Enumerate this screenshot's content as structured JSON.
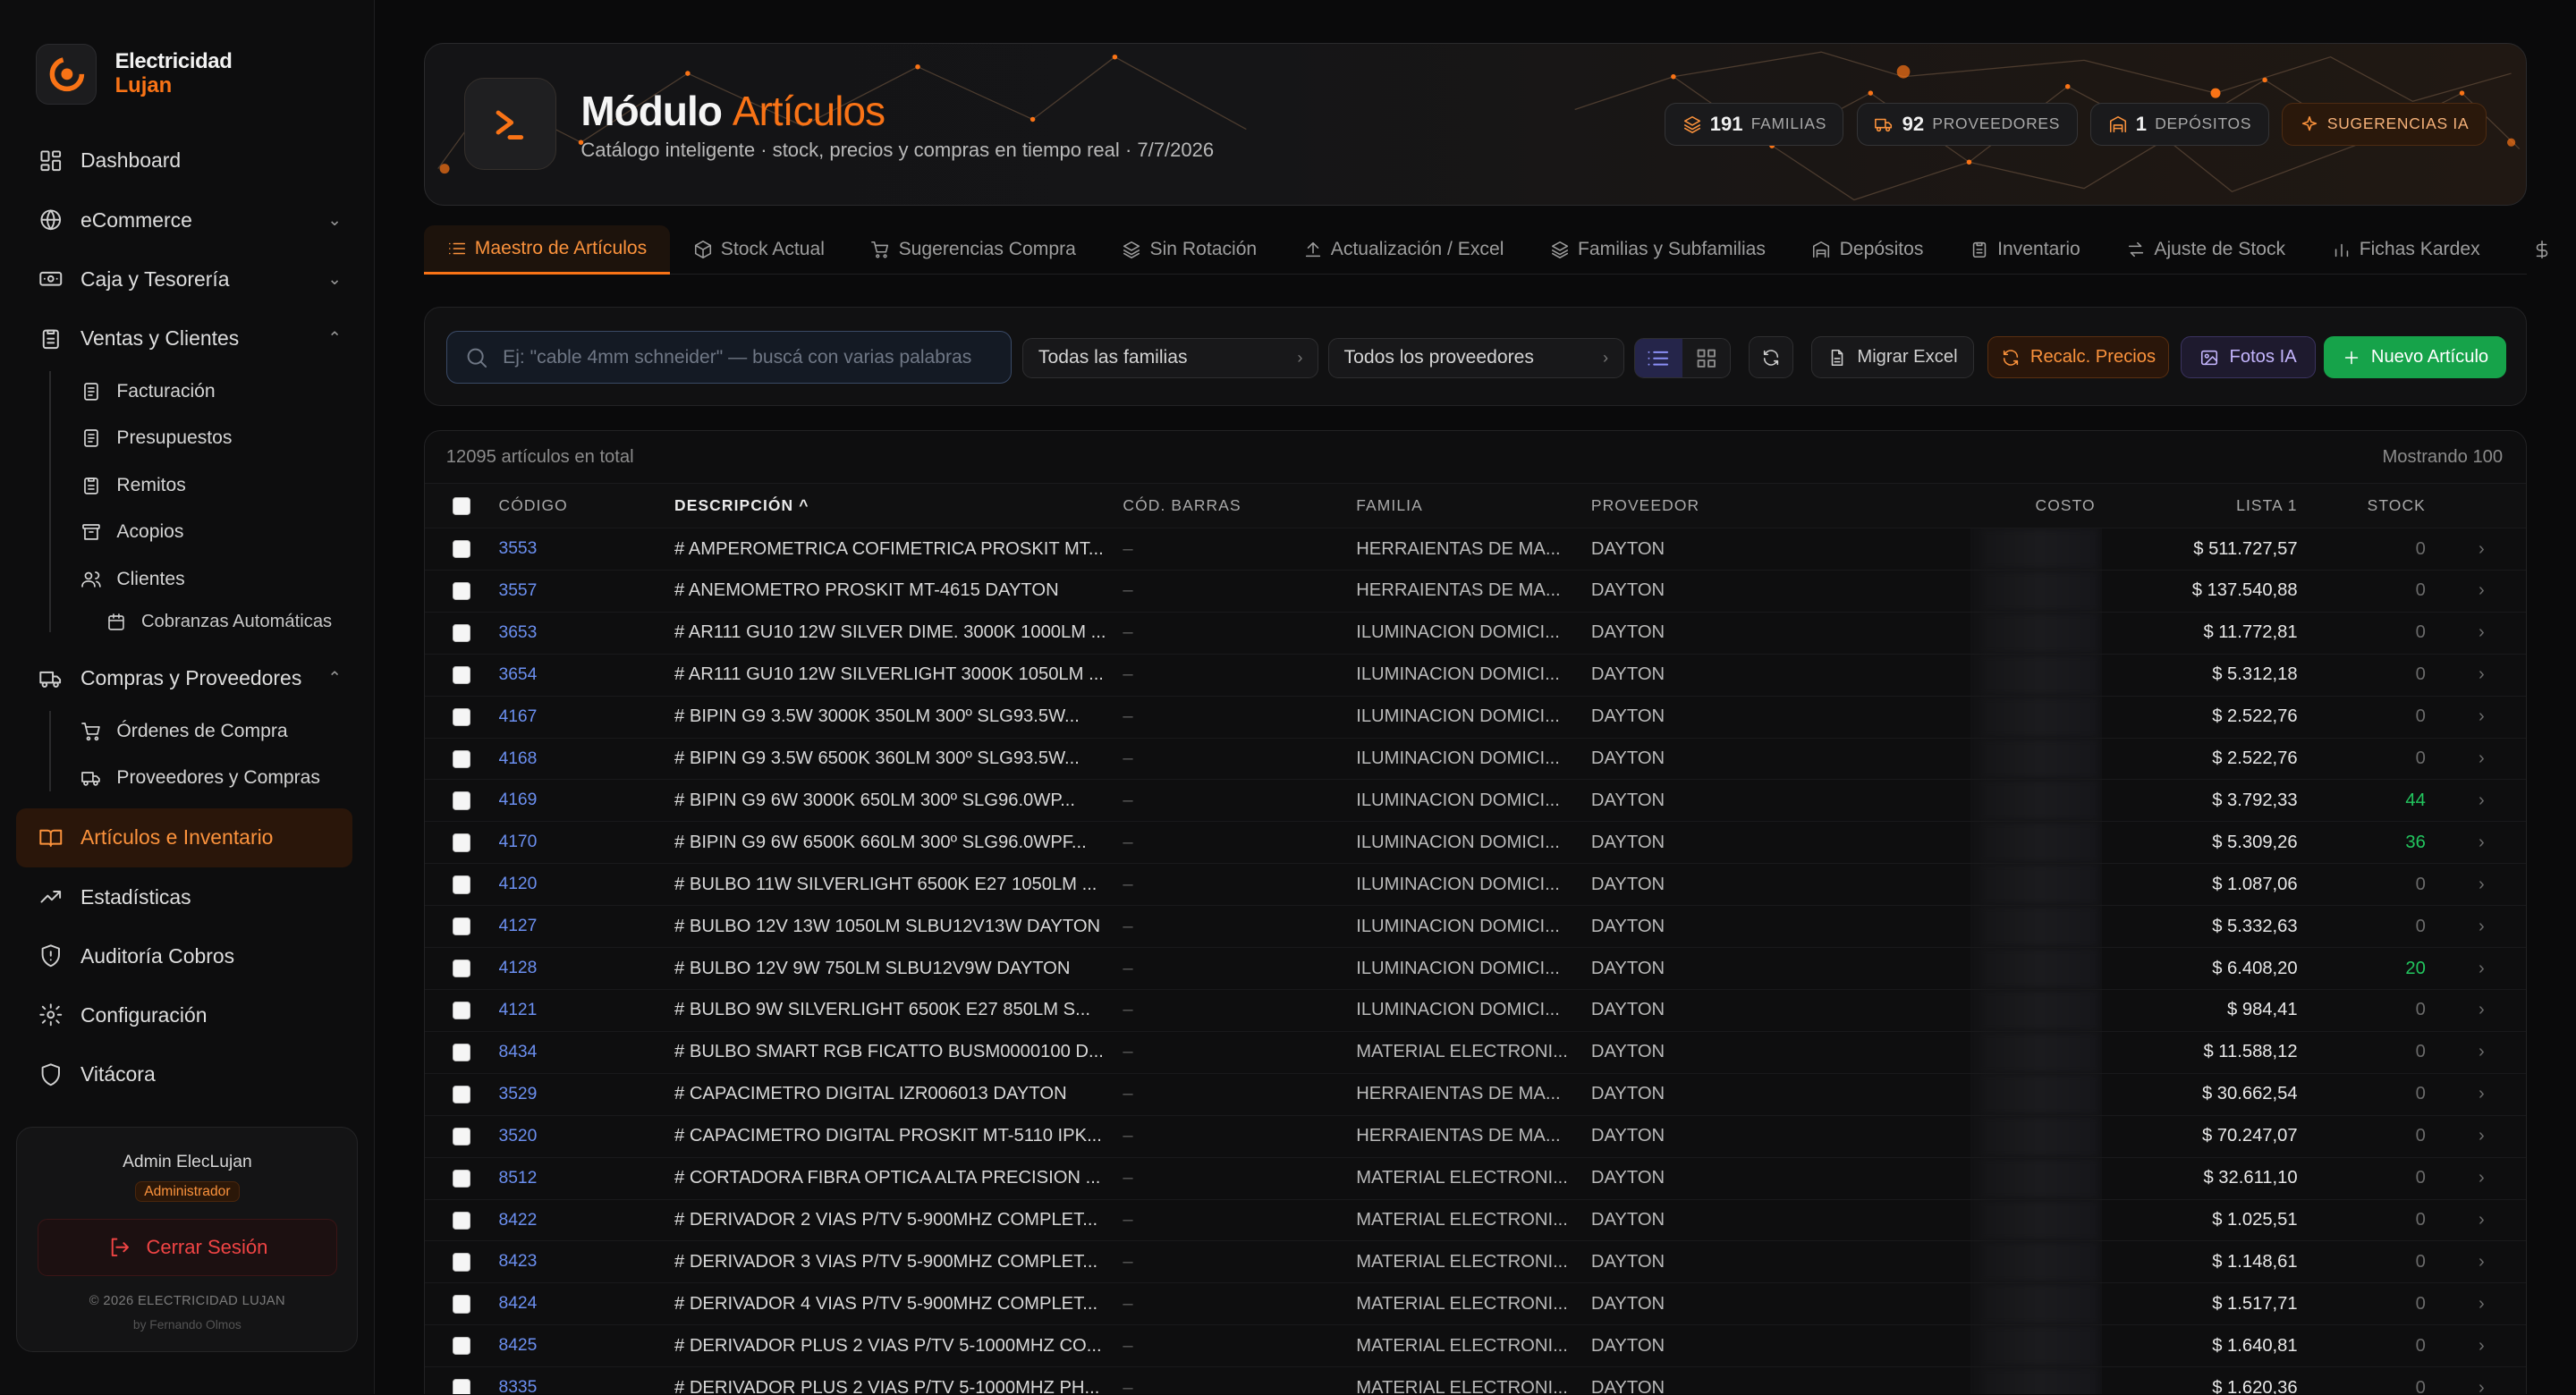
{
  "brand": {
    "line1": "Electricidad",
    "line2": "Lujan"
  },
  "nav": {
    "dashboard": "Dashboard",
    "ecommerce": "eCommerce",
    "caja": "Caja y Tesorería",
    "ventas": "Ventas y Clientes",
    "ventas_sub": [
      "Facturación",
      "Presupuestos",
      "Remitos",
      "Acopios",
      "Clientes"
    ],
    "cobranzas": "Cobranzas Automáticas",
    "compras": "Compras y Proveedores",
    "compras_sub": [
      "Órdenes de Compra",
      "Proveedores y Compras"
    ],
    "articulos": "Artículos e Inventario",
    "estadisticas": "Estadísticas",
    "auditoria": "Auditoría Cobros",
    "configuracion": "Configuración",
    "vitacora": "Vitácora"
  },
  "user": {
    "name": "Admin ElecLujan",
    "role": "Administrador",
    "logout": "Cerrar Sesión",
    "copyright": "© 2026 ELECTRICIDAD LUJAN",
    "by": "by Fernando Olmos"
  },
  "hero": {
    "title_a": "Módulo",
    "title_b": "Artículos",
    "subtitle": "Catálogo inteligente · stock, precios y compras en tiempo real · 7/7/2026"
  },
  "stats": [
    {
      "value": "191",
      "label": "FAMILIAS"
    },
    {
      "value": "92",
      "label": "PROVEEDORES"
    },
    {
      "value": "1",
      "label": "DEPÓSITOS"
    },
    {
      "value": "",
      "label": "SUGERENCIAS IA"
    }
  ],
  "tabs": [
    "Maestro de Artículos",
    "Stock Actual",
    "Sugerencias Compra",
    "Sin Rotación",
    "Actualización / Excel",
    "Familias y Subfamilias",
    "Depósitos",
    "Inventario",
    "Ajuste de Stock",
    "Fichas Kardex"
  ],
  "toolbar": {
    "search_placeholder": "Ej: \"cable 4mm schneider\" — buscá con varias palabras",
    "familias": "Todas las familias",
    "proveedores": "Todos los proveedores",
    "migrar": "Migrar Excel",
    "recalc": "Recalc. Precios",
    "fotos": "Fotos IA",
    "nuevo": "Nuevo Artículo"
  },
  "table": {
    "total": "12095 artículos en total",
    "showing": "Mostrando 100",
    "headers": {
      "codigo": "CÓDIGO",
      "descripcion": "DESCRIPCIÓN ^",
      "barras": "CÓD. BARRAS",
      "familia": "FAMILIA",
      "proveedor": "PROVEEDOR",
      "costo": "COSTO",
      "lista": "LISTA 1",
      "stock": "STOCK"
    },
    "rows": [
      [
        "3553",
        "# AMPEROMETRICA COFIMETRICA PROSKIT MT...",
        "–",
        "HERRAIENTAS DE MA...",
        "DAYTON",
        "$ 511.727,57",
        "0"
      ],
      [
        "3557",
        "# ANEMOMETRO PROSKIT MT-4615 DAYTON",
        "–",
        "HERRAIENTAS DE MA...",
        "DAYTON",
        "$ 137.540,88",
        "0"
      ],
      [
        "3653",
        "# AR111 GU10 12W SILVER DIME. 3000K 1000LM ...",
        "–",
        "ILUMINACION DOMICI...",
        "DAYTON",
        "$ 11.772,81",
        "0"
      ],
      [
        "3654",
        "# AR111 GU10 12W SILVERLIGHT 3000K 1050LM ...",
        "–",
        "ILUMINACION DOMICI...",
        "DAYTON",
        "$ 5.312,18",
        "0"
      ],
      [
        "4167",
        "# BIPIN G9 3.5W 3000K 350LM 300º SLG93.5W...",
        "–",
        "ILUMINACION DOMICI...",
        "DAYTON",
        "$ 2.522,76",
        "0"
      ],
      [
        "4168",
        "# BIPIN G9 3.5W 6500K 360LM 300º SLG93.5W...",
        "–",
        "ILUMINACION DOMICI...",
        "DAYTON",
        "$ 2.522,76",
        "0"
      ],
      [
        "4169",
        "# BIPIN G9 6W 3000K 650LM 300º SLG96.0WP...",
        "–",
        "ILUMINACION DOMICI...",
        "DAYTON",
        "$ 3.792,33",
        "44"
      ],
      [
        "4170",
        "# BIPIN G9 6W 6500K 660LM 300º SLG96.0WPF...",
        "–",
        "ILUMINACION DOMICI...",
        "DAYTON",
        "$ 5.309,26",
        "36"
      ],
      [
        "4120",
        "# BULBO 11W SILVERLIGHT 6500K E27 1050LM ...",
        "–",
        "ILUMINACION DOMICI...",
        "DAYTON",
        "$ 1.087,06",
        "0"
      ],
      [
        "4127",
        "# BULBO 12V 13W 1050LM SLBU12V13W DAYTON",
        "–",
        "ILUMINACION DOMICI...",
        "DAYTON",
        "$ 5.332,63",
        "0"
      ],
      [
        "4128",
        "# BULBO 12V 9W 750LM SLBU12V9W DAYTON",
        "–",
        "ILUMINACION DOMICI...",
        "DAYTON",
        "$ 6.408,20",
        "20"
      ],
      [
        "4121",
        "# BULBO 9W SILVERLIGHT 6500K E27 850LM S...",
        "–",
        "ILUMINACION DOMICI...",
        "DAYTON",
        "$ 984,41",
        "0"
      ],
      [
        "8434",
        "# BULBO SMART RGB FICATTO BUSM0000100 D...",
        "–",
        "MATERIAL ELECTRONI...",
        "DAYTON",
        "$ 11.588,12",
        "0"
      ],
      [
        "3529",
        "# CAPACIMETRO DIGITAL IZR006013 DAYTON",
        "–",
        "HERRAIENTAS DE MA...",
        "DAYTON",
        "$ 30.662,54",
        "0"
      ],
      [
        "3520",
        "# CAPACIMETRO DIGITAL PROSKIT MT-5110 IPK...",
        "–",
        "HERRAIENTAS DE MA...",
        "DAYTON",
        "$ 70.247,07",
        "0"
      ],
      [
        "8512",
        "# CORTADORA FIBRA OPTICA ALTA PRECISION ...",
        "–",
        "MATERIAL ELECTRONI...",
        "DAYTON",
        "$ 32.611,10",
        "0"
      ],
      [
        "8422",
        "# DERIVADOR 2 VIAS P/TV 5-900MHZ COMPLET...",
        "–",
        "MATERIAL ELECTRONI...",
        "DAYTON",
        "$ 1.025,51",
        "0"
      ],
      [
        "8423",
        "# DERIVADOR 3 VIAS P/TV 5-900MHZ COMPLET...",
        "–",
        "MATERIAL ELECTRONI...",
        "DAYTON",
        "$ 1.148,61",
        "0"
      ],
      [
        "8424",
        "# DERIVADOR 4 VIAS P/TV 5-900MHZ COMPLET...",
        "–",
        "MATERIAL ELECTRONI...",
        "DAYTON",
        "$ 1.517,71",
        "0"
      ],
      [
        "8425",
        "# DERIVADOR PLUS 2 VIAS P/TV 5-1000MHZ CO...",
        "–",
        "MATERIAL ELECTRONI...",
        "DAYTON",
        "$ 1.640,81",
        "0"
      ],
      [
        "8335",
        "# DERIVADOR PLUS 2 VIAS P/TV 5-1000MHZ PH...",
        "–",
        "MATERIAL ELECTRONI...",
        "DAYTON",
        "$ 1.620,36",
        "0"
      ]
    ]
  },
  "colors": {
    "accent": "#f97316",
    "success": "#22c55e",
    "primary_button": "#16a34a",
    "help": "#2563eb"
  }
}
